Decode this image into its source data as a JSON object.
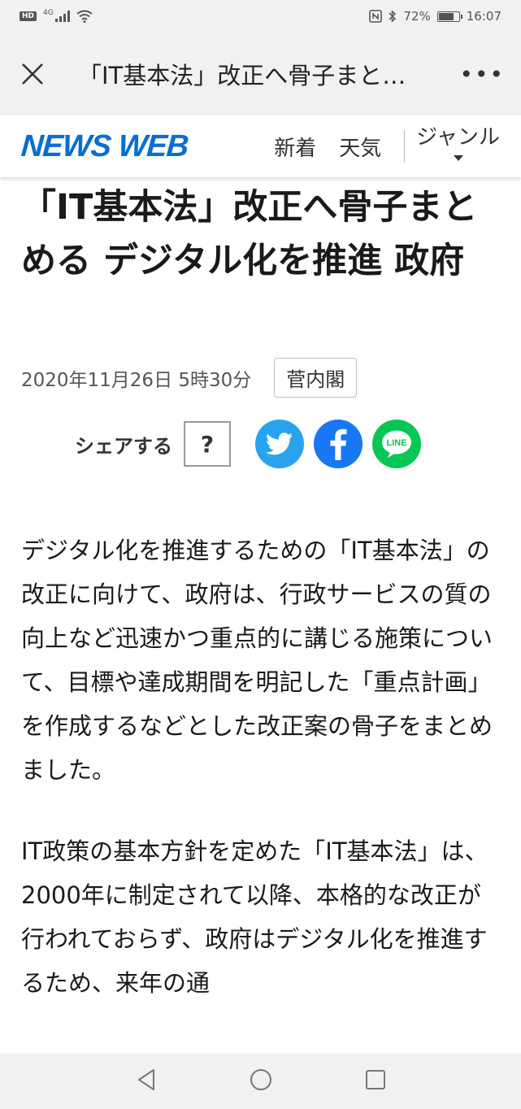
{
  "status_bar": {
    "hd": "HD",
    "network": "4G",
    "battery": "72%",
    "battery_level": 0.72,
    "time": "16:07"
  },
  "browser_bar": {
    "title": "「IT基本法」改正へ骨子まと…",
    "more": "•••"
  },
  "header": {
    "logo": "NEWS WEB",
    "nav": [
      "新着",
      "天気"
    ],
    "genre": "ジャンル"
  },
  "article": {
    "title": "「IT基本法」改正へ骨子まとめる デジタル化を推進 政府",
    "date": "2020年11月26日 5時30分",
    "tag": "菅内閣",
    "share_label": "シェアする",
    "help": "?",
    "paragraphs": [
      "デジタル化を推進するための「IT基本法」の改正に向けて、政府は、行政サービスの質の向上など迅速かつ重点的に講じる施策について、目標や達成期間を明記した「重点計画」を作成するなどとした改正案の骨子をまとめました。",
      "IT政策の基本方針を定めた「IT基本法」は、2000年に制定されて以降、本格的な改正が行われておらず、政府はデジタル化を推進するため、来年の通"
    ]
  },
  "colors": {
    "logo": "#0a6ed1",
    "twitter": "#2aa3ef",
    "facebook": "#1877f2",
    "line": "#06c755"
  },
  "icons": {
    "close": "close-icon",
    "twitter": "twitter-icon",
    "facebook": "facebook-icon",
    "line": "line-icon",
    "back": "back-icon",
    "home": "home-icon",
    "recent": "recent-apps-icon"
  }
}
